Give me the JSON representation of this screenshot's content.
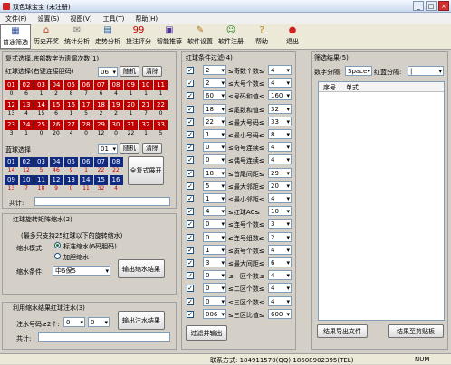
{
  "window": {
    "title": "双色球宝宝 (未注册)"
  },
  "menu": [
    "文件(F)",
    "设置(S)",
    "视图(V)",
    "工具(T)",
    "帮助(H)"
  ],
  "toolbar": [
    {
      "label": "普通筛选",
      "icon": "filter-icon",
      "glyph": "▦",
      "color": "#3050a0"
    },
    {
      "label": "历史开奖",
      "icon": "history-icon",
      "glyph": "⌂",
      "color": "#c04020"
    },
    {
      "label": "统计分析",
      "icon": "stats-icon",
      "glyph": "✉",
      "color": "#808080"
    },
    {
      "label": "走势分析",
      "icon": "trend-icon",
      "glyph": "▤",
      "color": "#2060b0"
    },
    {
      "label": "投注评分",
      "icon": "score-icon",
      "glyph": "99",
      "color": "#c00000"
    },
    {
      "label": "智能推荐",
      "icon": "recommend-icon",
      "glyph": "▣",
      "color": "#5030a0"
    },
    {
      "label": "软件设置",
      "icon": "settings-icon",
      "glyph": "✎",
      "color": "#b07020"
    },
    {
      "label": "软件注册",
      "icon": "register-icon",
      "glyph": "☺",
      "color": "#208020"
    },
    {
      "label": "帮助",
      "icon": "help-icon",
      "glyph": "?",
      "color": "#c08000"
    },
    {
      "label": "退出",
      "icon": "exit-icon",
      "glyph": "●",
      "color": "#d02020"
    }
  ],
  "compound": {
    "title": "复式选择,底部数字为遗漏次数(1)",
    "red_label": "红球选择(右键连接胆码)",
    "red_count": "06",
    "random": "随机",
    "clear": "清除",
    "red_balls": [
      "01",
      "02",
      "03",
      "04",
      "05",
      "06",
      "07",
      "08",
      "09",
      "10",
      "11",
      "12",
      "13",
      "14",
      "15",
      "16",
      "17",
      "18",
      "19",
      "20",
      "21",
      "22",
      "23",
      "24",
      "25",
      "26",
      "27",
      "28",
      "29",
      "30",
      "31",
      "32",
      "33"
    ],
    "red_miss": [
      "0",
      "6",
      "1",
      "2",
      "8",
      "7",
      "6",
      "4",
      "1",
      "1",
      "1",
      "13",
      "4",
      "15",
      "6",
      "1",
      "5",
      "2",
      "2",
      "1",
      "7",
      "0",
      "3",
      "1",
      "0",
      "20",
      "4",
      "0",
      "12",
      "0",
      "22",
      "1",
      "5"
    ],
    "blue_label": "蓝球选择",
    "blue_count": "01",
    "blue_balls": [
      "01",
      "02",
      "03",
      "04",
      "05",
      "06",
      "07",
      "08",
      "09",
      "10",
      "11",
      "12",
      "13",
      "14",
      "15",
      "16"
    ],
    "blue_miss": [
      "14",
      "12",
      "5",
      "46",
      "9",
      "1",
      "22",
      "22",
      "13",
      "7",
      "18",
      "9",
      "0",
      "11",
      "32",
      "4"
    ],
    "expand": "全复式展开",
    "total_label": "共计:"
  },
  "wheel": {
    "title": "红球旋转矩阵缩水(2)",
    "note": "(最多只支持25红球以下的旋转缩水)",
    "mode_label": "缩水模式:",
    "mode_standard": "标准缩水(6码胆码)",
    "mode_boost": "加胆缩水",
    "cond_label": "缩水条件:",
    "cond_value": "中6保5",
    "output": "输出缩水结果"
  },
  "inject": {
    "title": "利用缩水结果红球注水(3)",
    "label": "注水号码≥2个:",
    "v1": "0",
    "v2": "0",
    "output": "输出注水结果",
    "total_label": "共计:"
  },
  "filter": {
    "title": "红球条件过滤(4)",
    "rows": [
      {
        "lo": "2",
        "text": "≤奇数个数≤",
        "hi": "4"
      },
      {
        "lo": "2",
        "text": "≤大号个数≤",
        "hi": "4"
      },
      {
        "lo": "60",
        "text": "≤号码和值≤",
        "hi": "160"
      },
      {
        "lo": "18",
        "text": "≤尾数和值≤",
        "hi": "32"
      },
      {
        "lo": "22",
        "text": "≤最大号码≤",
        "hi": "33"
      },
      {
        "lo": "1",
        "text": "≤最小号码≤",
        "hi": "8"
      },
      {
        "lo": "0",
        "text": "≤奇号连续≤",
        "hi": "4"
      },
      {
        "lo": "0",
        "text": "≤偶号连续≤",
        "hi": "4"
      },
      {
        "lo": "18",
        "text": "≤首尾间距≤",
        "hi": "29"
      },
      {
        "lo": "5",
        "text": "≤最大邻距≤",
        "hi": "20"
      },
      {
        "lo": "1",
        "text": "≤最小邻距≤",
        "hi": "4"
      },
      {
        "lo": "4",
        "text": "≤红球AC≤",
        "hi": "10"
      },
      {
        "lo": "0",
        "text": "≤连号个数≤",
        "hi": "3"
      },
      {
        "lo": "0",
        "text": "≤连号组数≤",
        "hi": "2"
      },
      {
        "lo": "1",
        "text": "≤质号个数≤",
        "hi": "4"
      },
      {
        "lo": "3",
        "text": "≤最大间距≤",
        "hi": "6"
      },
      {
        "lo": "0",
        "text": "≤一区个数≤",
        "hi": "4"
      },
      {
        "lo": "0",
        "text": "≤二区个数≤",
        "hi": "4"
      },
      {
        "lo": "0",
        "text": "≤三区个数≤",
        "hi": "4"
      },
      {
        "lo": "006",
        "text": "≤三区比值≤",
        "hi": "600"
      }
    ],
    "output": "过滤并输出"
  },
  "results": {
    "title": "筛选结果(5)",
    "sep_label": "数字分隔:",
    "sep_value": "Space",
    "blue_sep_label": "红蓝分隔:",
    "blue_sep_value": "|",
    "col_no": "序号",
    "col_formula": "单式",
    "export": "结果导出文件",
    "copy": "结果至剪贴板"
  },
  "status": {
    "contact": "联系方式: 184911570(QQ)  18608902395(TEL)",
    "numlock": "NUM"
  }
}
